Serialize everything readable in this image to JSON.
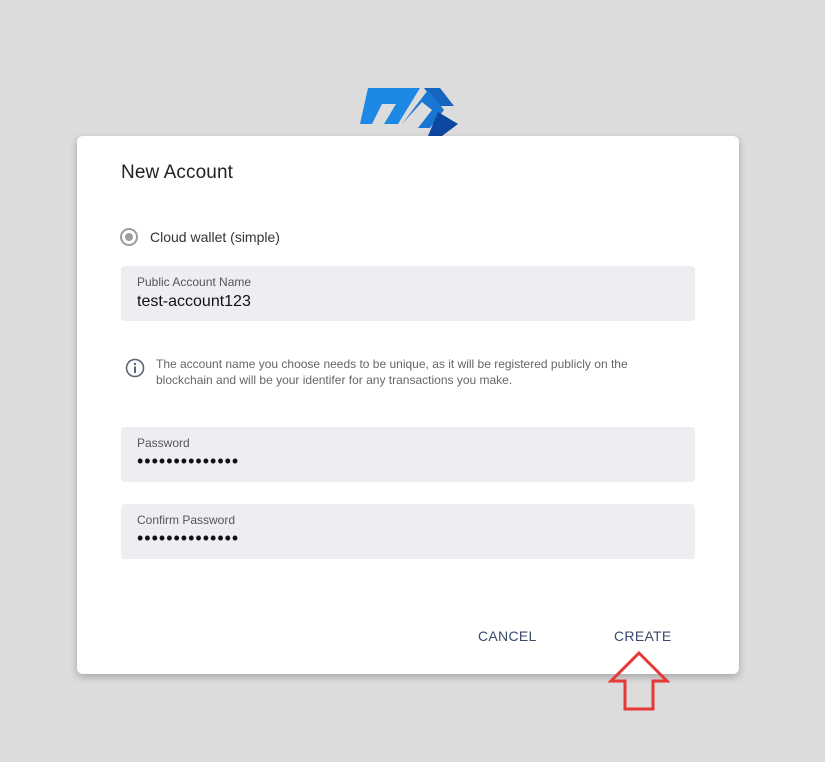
{
  "dialog": {
    "title": "New Account",
    "radio_label": "Cloud wallet (simple)",
    "account_name": {
      "label": "Public Account Name",
      "value": "test-account123"
    },
    "info_text": "The account name you choose needs to be unique, as it will be registered publicly on the blockchain and will be your identifer for any transactions you make.",
    "password": {
      "label": "Password",
      "value": "••••••••••••••"
    },
    "confirm_password": {
      "label": "Confirm Password",
      "value": "••••••••••••••"
    },
    "cancel_label": "CANCEL",
    "create_label": "CREATE"
  },
  "colors": {
    "logo_blue": "#1565c0",
    "logo_light_blue": "#1e88e5",
    "arrow_red": "#e53935"
  },
  "icons": {
    "logo": "app-logo-icon",
    "info": "info-icon",
    "annotation": "up-arrow-icon"
  }
}
